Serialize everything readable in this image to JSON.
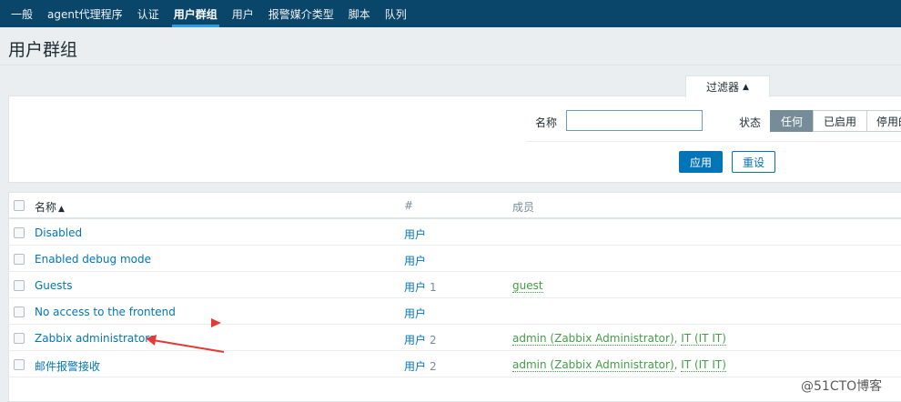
{
  "nav": {
    "items": [
      {
        "label": "一般",
        "active": false
      },
      {
        "label": "agent代理程序",
        "active": false
      },
      {
        "label": "认证",
        "active": false
      },
      {
        "label": "用户群组",
        "active": true
      },
      {
        "label": "用户",
        "active": false
      },
      {
        "label": "报警媒介类型",
        "active": false
      },
      {
        "label": "脚本",
        "active": false
      },
      {
        "label": "队列",
        "active": false
      }
    ]
  },
  "page": {
    "title": "用户群组"
  },
  "filter": {
    "tab_label": "过滤器",
    "name_label": "名称",
    "name_value": "",
    "status_label": "状态",
    "status_options": [
      "任何",
      "已启用",
      "停用的"
    ],
    "status_selected": "任何",
    "apply_label": "应用",
    "reset_label": "重设"
  },
  "table": {
    "headers": {
      "name": "名称",
      "hash": "#",
      "members": "成员"
    },
    "rows": [
      {
        "name": "Disabled",
        "users_label": "用户",
        "count": "",
        "members": []
      },
      {
        "name": "Enabled debug mode",
        "users_label": "用户",
        "count": "",
        "members": []
      },
      {
        "name": "Guests",
        "users_label": "用户",
        "count": "1",
        "members": [
          "guest"
        ]
      },
      {
        "name": "No access to the frontend",
        "users_label": "用户",
        "count": "",
        "members": []
      },
      {
        "name": "Zabbix administrators",
        "users_label": "用户",
        "count": "2",
        "members": [
          "admin (Zabbix Administrator)",
          "IT (IT IT)"
        ]
      },
      {
        "name": "邮件报警接收",
        "users_label": "用户",
        "count": "2",
        "members": [
          "admin (Zabbix Administrator)",
          "IT (IT IT)"
        ]
      }
    ]
  },
  "watermark": "@51CTO博客",
  "colors": {
    "nav_bg": "#0a466a",
    "link": "#0275b8",
    "member_link": "#429e47",
    "annotation": "#e53935"
  }
}
